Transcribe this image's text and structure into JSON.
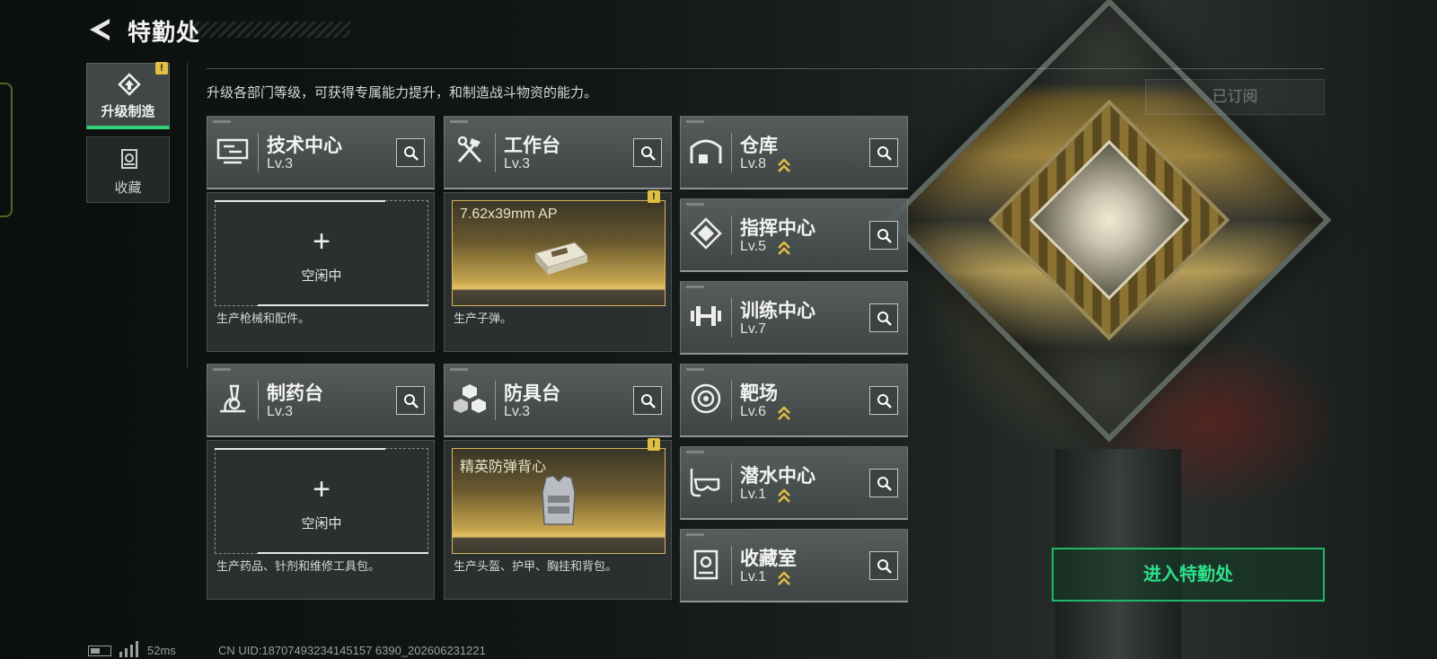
{
  "header": {
    "title": "特勤处",
    "back_icon": "back-arrow-icon"
  },
  "side_tabs": [
    {
      "label": "升级制造",
      "icon": "upgrade-craft-icon",
      "active": true,
      "badge": "!"
    },
    {
      "label": "收藏",
      "icon": "collection-icon",
      "active": false
    }
  ],
  "description": "升级各部门等级，可获得专属能力提升，和制造战斗物资的能力。",
  "subscribed_label": "已订阅",
  "departments": [
    {
      "name": "技术中心",
      "level": "Lv.3",
      "icon": "tech-center-icon",
      "upgrade_available": false
    },
    {
      "name": "工作台",
      "level": "Lv.3",
      "icon": "workbench-icon",
      "upgrade_available": false
    },
    {
      "name": "仓库",
      "level": "Lv.8",
      "icon": "warehouse-icon",
      "upgrade_available": true
    },
    {
      "name": "指挥中心",
      "level": "Lv.5",
      "icon": "command-center-icon",
      "upgrade_available": true
    },
    {
      "name": "训练中心",
      "level": "Lv.7",
      "icon": "training-center-icon",
      "upgrade_available": false
    },
    {
      "name": "制药台",
      "level": "Lv.3",
      "icon": "pharmacy-icon",
      "upgrade_available": false
    },
    {
      "name": "防具台",
      "level": "Lv.3",
      "icon": "armor-bench-icon",
      "upgrade_available": false
    },
    {
      "name": "靶场",
      "level": "Lv.6",
      "icon": "shooting-range-icon",
      "upgrade_available": true
    },
    {
      "name": "潜水中心",
      "level": "Lv.1",
      "icon": "diving-center-icon",
      "upgrade_available": true
    },
    {
      "name": "收藏室",
      "level": "Lv.1",
      "icon": "collection-room-icon",
      "upgrade_available": true
    }
  ],
  "production": {
    "tech": {
      "state": "空闲中",
      "note": "生产枪械和配件。"
    },
    "workbench": {
      "item": "7.62x39mm AP",
      "note": "生产子弹。",
      "badge": "!"
    },
    "pharmacy": {
      "state": "空闲中",
      "note": "生产药品、针剂和维修工具包。"
    },
    "armor": {
      "item": "精英防弹背心",
      "note": "生产头盔、护甲、胸挂和背包。",
      "badge": "!"
    }
  },
  "enter_button": "进入特勤处",
  "status": {
    "ping": "52ms",
    "uid": "CN UID:18707493234145157 6390_202606231221"
  },
  "colors": {
    "accent_green": "#2ee08a",
    "gold": "#d8b85a",
    "warning": "#e0c040"
  }
}
